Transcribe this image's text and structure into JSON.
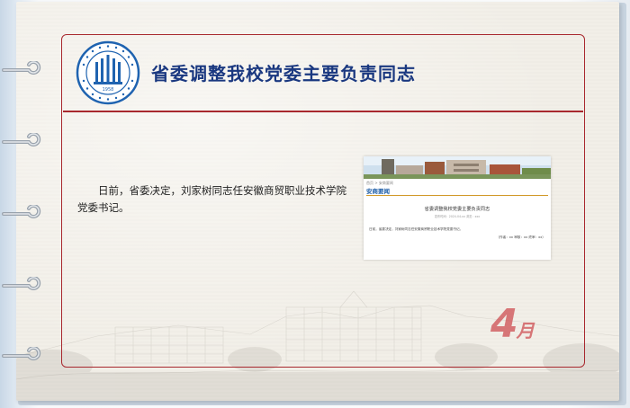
{
  "article": {
    "title": "省委调整我校党委主要负责同志",
    "body": "日前，省委决定，刘家树同志任安徽商贸职业技术学院党委书记。"
  },
  "news_screenshot": {
    "breadcrumb": "首页 > 安商要闻",
    "section": "安商要闻",
    "headline": "省委调整我校党委主要负责同志",
    "meta": "发布时间：2024-04-xx  浏览：xxx",
    "body": "日前，省委决定，刘家树同志任安徽商贸职业技术学院党委书记。",
    "signature": "（作者：xx  审核：xx  终审：xx）"
  },
  "month": {
    "number": "4",
    "unit": "月"
  },
  "logo": {
    "name": "school-emblem",
    "year": "1958"
  },
  "colors": {
    "frame": "#a8282e",
    "title": "#1a3880",
    "month": "#cd4e52",
    "ring": "#9aa3ad"
  }
}
